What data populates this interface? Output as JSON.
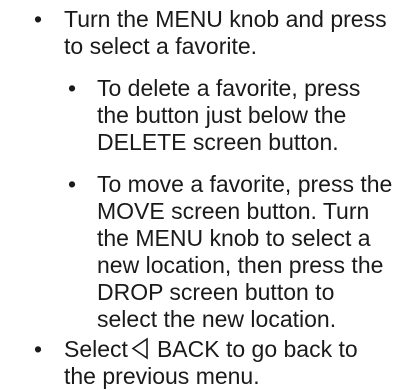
{
  "list": {
    "item1": {
      "lines": [
        "Turn the MENU knob and press",
        "to select a favorite."
      ]
    },
    "item1a": {
      "lines": [
        "To delete a favorite, press",
        "the button just below the",
        "DELETE screen button."
      ]
    },
    "item1b": {
      "lines": [
        "To move a favorite, press the",
        "MOVE screen button. Turn",
        "the MENU knob to select a",
        "new location, then press the",
        "DROP screen button to",
        "select the new location."
      ]
    },
    "item2": {
      "select_word": "Select",
      "back_word": "BACK to go back to",
      "line2": "the previous menu.",
      "icon": "back-triangle-icon"
    }
  }
}
